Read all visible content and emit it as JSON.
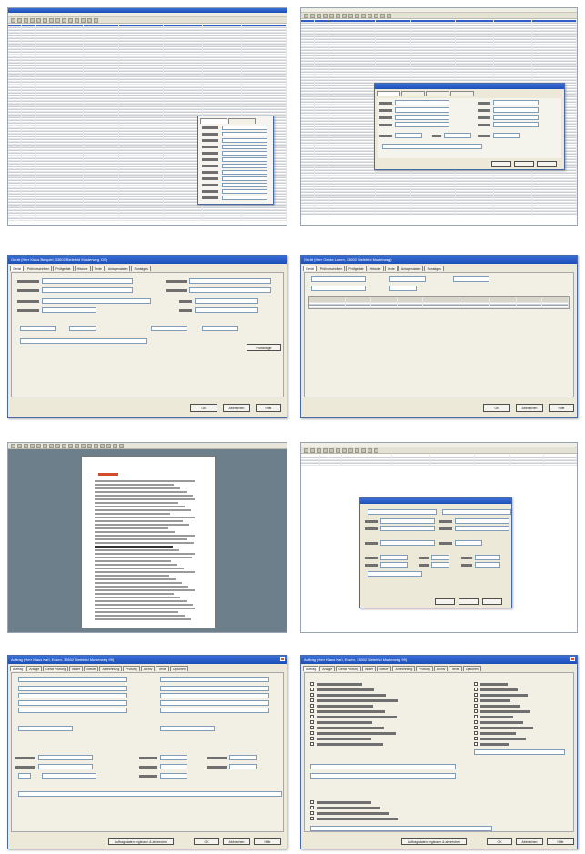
{
  "thumbnails": [
    {
      "id": "t1",
      "kind": "table-list-with-popup"
    },
    {
      "id": "t2",
      "kind": "table-list-with-dialog"
    },
    {
      "id": "t3",
      "kind": "form-dialog"
    },
    {
      "id": "t4",
      "kind": "form-dialog-with-table"
    },
    {
      "id": "t5",
      "kind": "document-preview"
    },
    {
      "id": "t6",
      "kind": "list-with-dialog"
    },
    {
      "id": "t7",
      "kind": "form-dialog-large"
    },
    {
      "id": "t8",
      "kind": "checklist-dialog"
    }
  ],
  "dialogs": {
    "t3": {
      "title": "Gerät (Herr Klaus Beispiel, 33602 Bielefeld Musterweg, DS)",
      "tabs": [
        "Gerät",
        "Prüfvorschriften",
        "Prüfgeräte",
        "Historie",
        "Texte",
        "Anlagendaten",
        "Sonstiges"
      ],
      "ok": "OK",
      "cancel": "Abbrechen",
      "help": "Hilfe",
      "button_dropdown": "Prüfanlage"
    },
    "t4": {
      "title": "Gerät (Herr Gerda Lamm, 33602 Bielefeld Musterweg)",
      "tabs": [
        "Gerät",
        "Prüfvorschriften",
        "Prüfgeräte",
        "Historie",
        "Texte",
        "Anlagendaten",
        "Sonstiges"
      ],
      "ok": "OK",
      "cancel": "Abbrechen",
      "help": "Hilfe"
    },
    "t7": {
      "title": "Auftrag (Herr Klaus Karl, Essen, 33602 Bielefeld Musterweg 99)",
      "tabs": [
        "Auftrag",
        "Anlage",
        "Gerät Prüfung",
        "Bilder",
        "Steuer",
        "Abrechnung",
        "Prüfung",
        "Archiv",
        "Texte",
        "Optionen"
      ],
      "ok": "OK",
      "cancel": "Abbrechen",
      "help": "Hilfe",
      "footer_button": "Auftragsdaten ergänzen & abbrechen"
    },
    "t8": {
      "title": "Auftrag (Herr Klaus Karl, Essen, 33602 Bielefeld Musterweg 99)",
      "tabs": [
        "Auftrag",
        "Anlage",
        "Gerät Prüfung",
        "Bilder",
        "Steuer",
        "Abrechnung",
        "Prüfung",
        "Archiv",
        "Texte",
        "Optionen"
      ],
      "ok": "OK",
      "cancel": "Abbrechen",
      "help": "Hilfe",
      "footer_button": "Auftragsdaten ergänzen & abbrechen"
    }
  },
  "colors": {
    "titlebar": "#1d4fb8",
    "window_bg": "#ece9d8",
    "selection": "#2f5fc6",
    "doc_accent": "#d24b2b"
  }
}
